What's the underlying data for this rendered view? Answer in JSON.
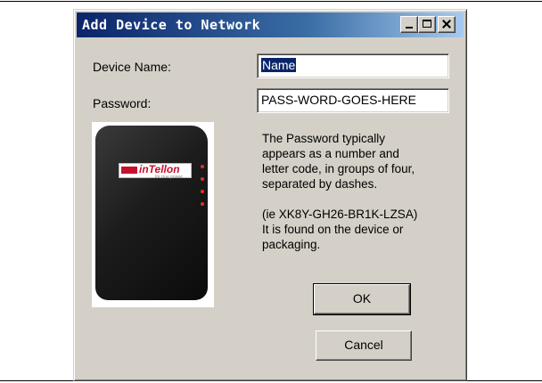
{
  "window": {
    "title": "Add Device to Network",
    "controls": {
      "minimize": "minimize",
      "maximize": "maximize",
      "close": "close"
    }
  },
  "form": {
    "device_name_label": "Device Name:",
    "device_name_value": "Name",
    "password_label": "Password:",
    "password_value": "PASS-WORD-GOES-HERE"
  },
  "help": {
    "lines": [
      "The Password typically",
      "appears as a number and",
      "letter code, in groups of four,",
      "separated by dashes.",
      "",
      "(ie XK8Y-GH26-BR1K-LZSA)",
      "It is found on the device or",
      "packaging."
    ]
  },
  "device_image": {
    "brand": "inTellon",
    "tagline": "for true power"
  },
  "buttons": {
    "ok_label": "OK",
    "cancel_label": "Cancel"
  }
}
